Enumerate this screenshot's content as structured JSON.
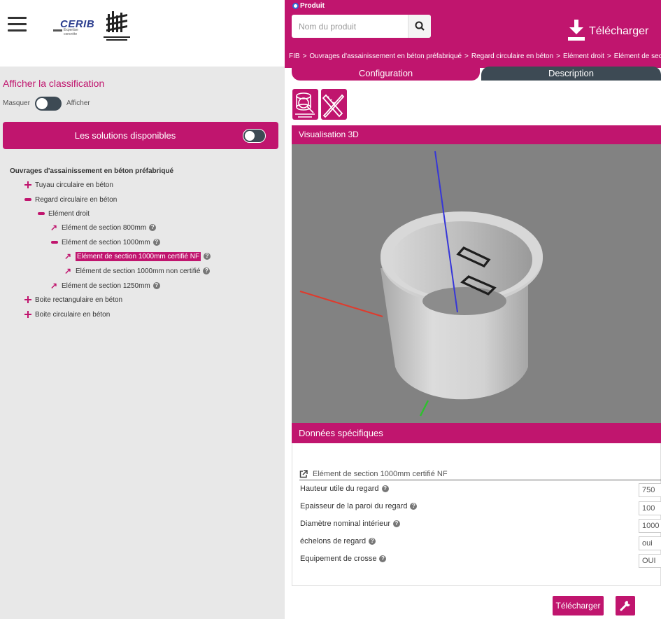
{
  "sidebar": {
    "title": "Afficher la classification",
    "toggle_off_label": "Masquer",
    "toggle_on_label": "Afficher",
    "solutions_label": "Les solutions disponibles",
    "tree": [
      {
        "label": "Ouvrages d'assainissement en béton préfabriqué",
        "icon": "none",
        "level": 0,
        "help": false,
        "selected": false
      },
      {
        "label": "Tuyau circulaire en béton",
        "icon": "plus-icon",
        "level": 1,
        "help": false,
        "selected": false
      },
      {
        "label": "Regard circulaire en béton",
        "icon": "minus-icon",
        "level": 1,
        "help": false,
        "selected": false
      },
      {
        "label": "Elément droit",
        "icon": "minus-icon",
        "level": 2,
        "help": false,
        "selected": false
      },
      {
        "label": "Elément de section 800mm",
        "icon": "arrow-icon",
        "level": 3,
        "help": true,
        "selected": false
      },
      {
        "label": "Elément de section 1000mm",
        "icon": "minus-icon",
        "level": 3,
        "help": true,
        "selected": false
      },
      {
        "label": "Elément de section 1000mm certifié NF",
        "icon": "arrow-icon",
        "level": 4,
        "help": true,
        "selected": true
      },
      {
        "label": "Elément de section 1000mm non certifié",
        "icon": "arrow-icon",
        "level": 4,
        "help": true,
        "selected": false
      },
      {
        "label": "Elément de section 1250mm",
        "icon": "arrow-icon",
        "level": 3,
        "help": true,
        "selected": false
      },
      {
        "label": "Boite rectangulaire en béton",
        "icon": "plus-icon",
        "level": 1,
        "help": false,
        "selected": false
      },
      {
        "label": "Boite circulaire en béton",
        "icon": "plus-icon",
        "level": 1,
        "help": false,
        "selected": false
      }
    ]
  },
  "header": {
    "radio_label": "Produit",
    "search_placeholder": "Nom du produit",
    "download_label": "Télécharger",
    "breadcrumb": [
      "FIB",
      "Ouvrages d'assainissement en béton préfabriqué",
      "Regard circulaire en béton",
      "Elément droit",
      "Elément de section"
    ]
  },
  "tabs": {
    "configuration": "Configuration",
    "description": "Description"
  },
  "viewer": {
    "title": "Visualisation 3D"
  },
  "data": {
    "title": "Données spécifiques",
    "product_name": "Elément de section 1000mm certifié NF",
    "params": [
      {
        "label": "Hauteur utile du regard",
        "value": "750"
      },
      {
        "label": "Epaisseur de la paroi du regard",
        "value": "100"
      },
      {
        "label": "Diamètre nominal intérieur",
        "value": "1000"
      },
      {
        "label": "échelons de regard",
        "value": "oui"
      },
      {
        "label": "Equipement de crosse",
        "value": "OUI"
      }
    ]
  },
  "footer": {
    "download_label": "Télécharger"
  },
  "colors": {
    "accent": "#c0156e",
    "dark": "#3d4a54",
    "viewer_bg": "#828282"
  }
}
